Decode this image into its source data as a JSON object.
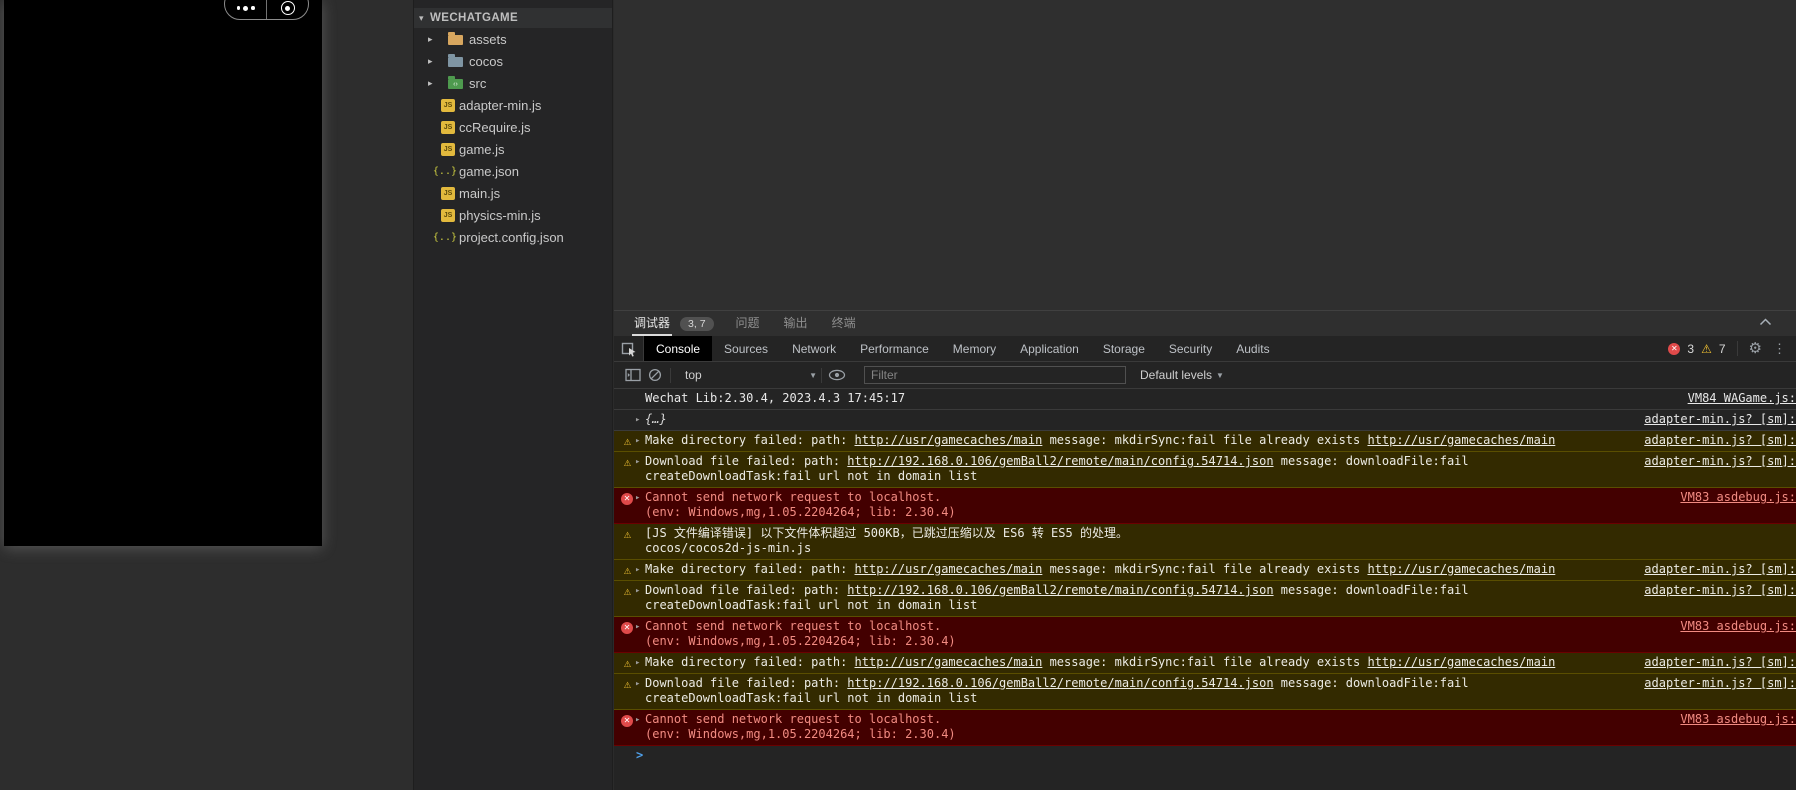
{
  "icons": {
    "root_chevron": "▾",
    "folder_chevron": "▸",
    "expand_arrow": "▸",
    "js_badge": "JS",
    "braces": "{..}",
    "code_glyph": "‹›",
    "warning": "⚠",
    "error_x": "✕",
    "gear": "⚙",
    "kebab": "⋮",
    "dropdown_arrow": "▼"
  },
  "explorer": {
    "root": "WECHATGAME",
    "items": [
      {
        "label": "assets",
        "kind": "folder"
      },
      {
        "label": "cocos",
        "kind": "folder"
      },
      {
        "label": "src",
        "kind": "folder"
      },
      {
        "label": "adapter-min.js",
        "kind": "js"
      },
      {
        "label": "ccRequire.js",
        "kind": "js"
      },
      {
        "label": "game.js",
        "kind": "js"
      },
      {
        "label": "game.json",
        "kind": "json"
      },
      {
        "label": "main.js",
        "kind": "js"
      },
      {
        "label": "physics-min.js",
        "kind": "js"
      },
      {
        "label": "project.config.json",
        "kind": "json"
      }
    ]
  },
  "panel": {
    "debugger_tab": "调试器",
    "badge": "3, 7",
    "problems_tab": "问题",
    "output_tab": "输出",
    "terminal_tab": "终端"
  },
  "devtools": {
    "tabs": [
      "Console",
      "Sources",
      "Network",
      "Performance",
      "Memory",
      "Application",
      "Storage",
      "Security",
      "Audits"
    ],
    "active_tab": "Console",
    "counts": {
      "errors": "3",
      "warnings": "7"
    },
    "toolbar": {
      "context": "top",
      "filter_placeholder": "Filter",
      "levels": "Default levels"
    }
  },
  "console": {
    "prompt": ">",
    "messages": [
      {
        "type": "log",
        "text": "Wechat Lib:2.30.4, 2023.4.3 17:45:17",
        "source": "VM84 WAGame.js:"
      },
      {
        "type": "log",
        "text": "{…}",
        "source": "adapter-min.js? [sm]:"
      },
      {
        "type": "warning",
        "pre": "Make directory failed: path: ",
        "url1": "http://usr/gamecaches/main",
        "mid": " message: mkdirSync:fail file already exists ",
        "url2": "http://usr/gamecaches/main",
        "source": "adapter-min.js? [sm]:"
      },
      {
        "type": "warning",
        "pre": "Download file failed: path: ",
        "url1": "http://192.168.0.106/gemBall2/remote/main/config.54714.json",
        "mid": " message: downloadFile:fail createDownloadTask:fail url not in domain list",
        "source": "adapter-min.js? [sm]:"
      },
      {
        "type": "error",
        "line1": "Cannot send network request to localhost.",
        "line2": "(env: Windows,mg,1.05.2204264; lib: 2.30.4)",
        "source": "VM83 asdebug.js:"
      },
      {
        "type": "warning",
        "line1": "[JS 文件编译错误] 以下文件体积超过 500KB，已跳过压缩以及 ES6 转 ES5 的处理。",
        "line2": "cocos/cocos2d-js-min.js"
      },
      {
        "type": "warning",
        "pre": "Make directory failed: path: ",
        "url1": "http://usr/gamecaches/main",
        "mid": " message: mkdirSync:fail file already exists ",
        "url2": "http://usr/gamecaches/main",
        "source": "adapter-min.js? [sm]:"
      },
      {
        "type": "warning",
        "pre": "Download file failed: path: ",
        "url1": "http://192.168.0.106/gemBall2/remote/main/config.54714.json",
        "mid": " message: downloadFile:fail createDownloadTask:fail url not in domain list",
        "source": "adapter-min.js? [sm]:"
      },
      {
        "type": "error",
        "line1": "Cannot send network request to localhost.",
        "line2": "(env: Windows,mg,1.05.2204264; lib: 2.30.4)",
        "source": "VM83 asdebug.js:"
      },
      {
        "type": "warning",
        "pre": "Make directory failed: path: ",
        "url1": "http://usr/gamecaches/main",
        "mid": " message: mkdirSync:fail file already exists ",
        "url2": "http://usr/gamecaches/main",
        "source": "adapter-min.js? [sm]:"
      },
      {
        "type": "warning",
        "pre": "Download file failed: path: ",
        "url1": "http://192.168.0.106/gemBall2/remote/main/config.54714.json",
        "mid": " message: downloadFile:fail createDownloadTask:fail url not in domain list",
        "source": "adapter-min.js? [sm]:"
      },
      {
        "type": "error",
        "line1": "Cannot send network request to localhost.",
        "line2": "(env: Windows,mg,1.05.2204264; lib: 2.30.4)",
        "source": "VM83 asdebug.js:"
      }
    ]
  },
  "colors": {
    "warning_bg": "#332a00",
    "error_bg": "#430000",
    "warning_icon": "#f1c232",
    "error_icon": "#e04a4a",
    "prompt_blue": "#4f9fe8",
    "active_tab_bg": "#000000"
  }
}
